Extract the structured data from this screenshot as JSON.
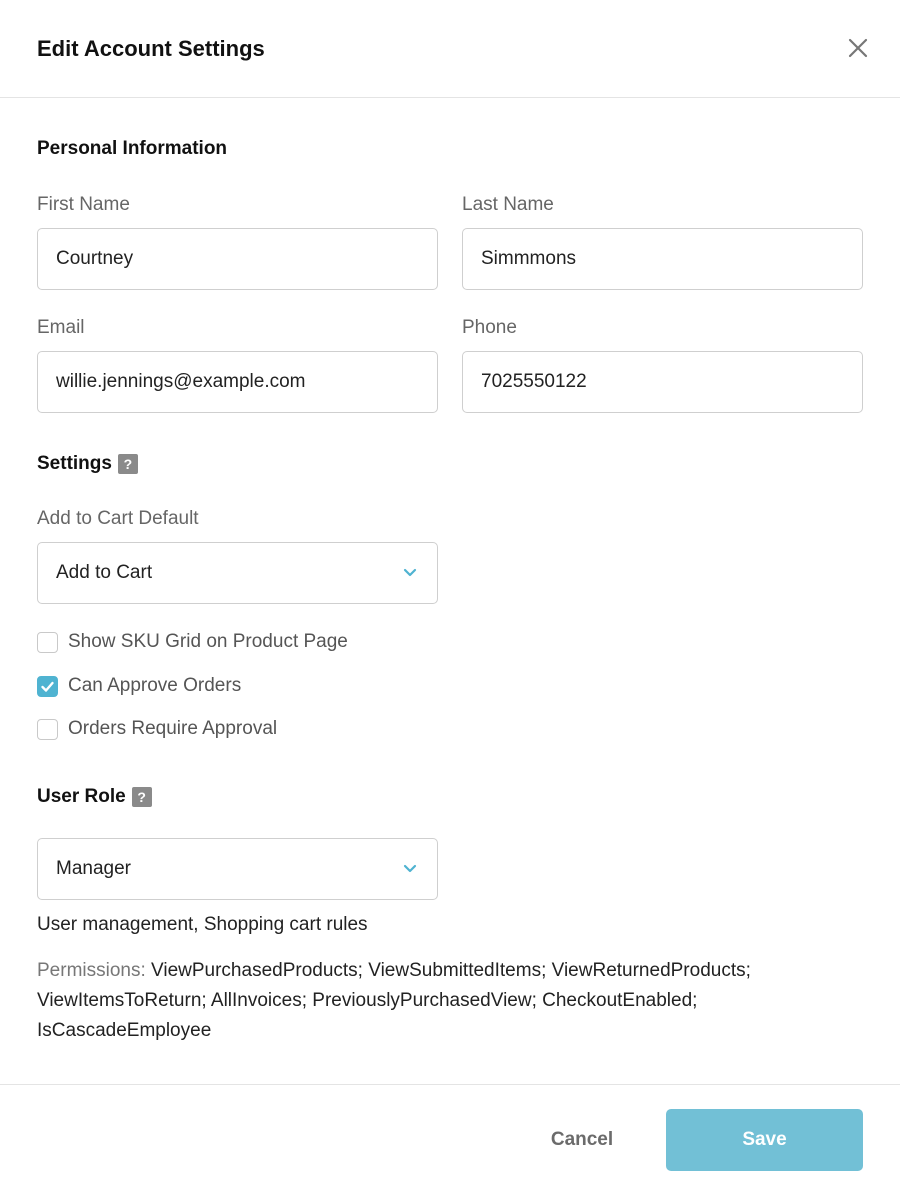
{
  "header": {
    "title": "Edit Account Settings",
    "close_icon": "close-icon"
  },
  "personal": {
    "section_title": "Personal Information",
    "first_name": {
      "label": "First Name",
      "value": "Courtney"
    },
    "last_name": {
      "label": "Last Name",
      "value": "Simmmons"
    },
    "email": {
      "label": "Email",
      "value": "willie.jennings@example.com"
    },
    "phone": {
      "label": "Phone",
      "value": "7025550122"
    }
  },
  "settings": {
    "section_title": "Settings",
    "help_icon": "?",
    "add_to_cart_default": {
      "label": "Add to Cart Default",
      "value": "Add to Cart"
    },
    "checkboxes": [
      {
        "label": "Show SKU Grid on Product Page",
        "checked": false
      },
      {
        "label": "Can Approve Orders",
        "checked": true
      },
      {
        "label": "Orders Require Approval",
        "checked": false
      }
    ]
  },
  "user_role": {
    "section_title": "User Role",
    "help_icon": "?",
    "value": "Manager",
    "description": "User management, Shopping cart rules",
    "permissions_label": "Permissions:",
    "permissions_text": "ViewPurchasedProducts; ViewSubmittedItems; ViewReturnedProducts; ViewItemsToReturn; AllInvoices; PreviouslyPurchasedView; CheckoutEnabled; IsCascadeEmployee"
  },
  "footer": {
    "cancel_label": "Cancel",
    "save_label": "Save"
  },
  "colors": {
    "accent": "#4fb3d1",
    "save_button": "#72c0d6",
    "help_icon_bg": "#8a8a8a"
  }
}
